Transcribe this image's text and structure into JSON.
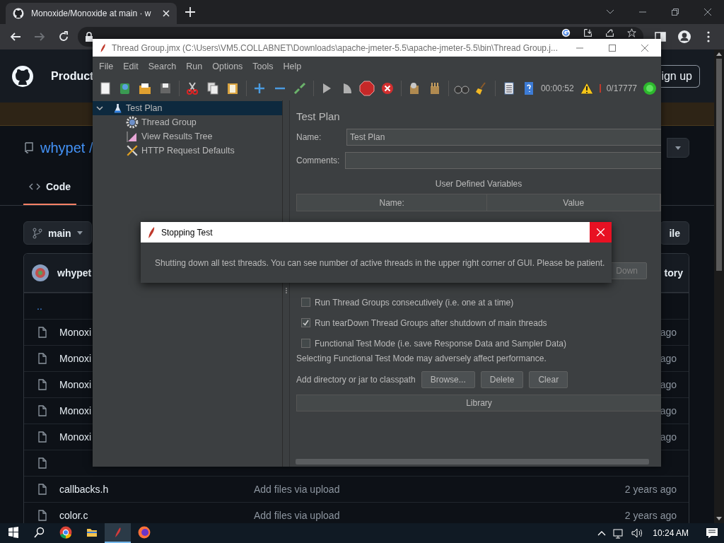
{
  "browser": {
    "tab": {
      "title": "Monoxide/Monoxide at main · w"
    }
  },
  "github": {
    "nav": "Product",
    "signup": "ign up",
    "repo_owner": "whypet /",
    "tabs": [
      {
        "label": "Code",
        "selected": true
      }
    ],
    "branch": "main",
    "file_button": "ile",
    "commit_author": "whypet",
    "history": "tory",
    "rows": [
      {
        "kind": "parent",
        "name": ".."
      },
      {
        "kind": "file",
        "name": "Monoxi",
        "time": "ago"
      },
      {
        "kind": "file",
        "name": "Monoxi",
        "time": "ago"
      },
      {
        "kind": "file",
        "name": "Monoxi",
        "time": "ago"
      },
      {
        "kind": "file",
        "name": "Monoxi",
        "time": "ago"
      },
      {
        "kind": "file",
        "name": "Monoxi",
        "time": "ago"
      },
      {
        "kind": "file"
      },
      {
        "kind": "file",
        "name": "callbacks.h",
        "message": "Add files via upload",
        "time": "2 years ago"
      },
      {
        "kind": "file",
        "name": "color.c",
        "message": "Add files via upload",
        "time": "2 years ago"
      }
    ]
  },
  "jmeter": {
    "title": "Thread Group.jmx (C:\\Users\\VM5.COLLABNET\\Downloads\\apache-jmeter-5.5\\apache-jmeter-5.5\\bin\\Thread Group.j...",
    "menu": [
      "File",
      "Edit",
      "Search",
      "Run",
      "Options",
      "Tools",
      "Help"
    ],
    "elapsed": "00:00:52",
    "threads": "0/17777",
    "tree": [
      {
        "label": "Test Plan",
        "kind": "plan",
        "selected": true,
        "expanded": true,
        "children": [
          {
            "label": "Thread Group",
            "kind": "thread",
            "selected": false
          },
          {
            "label": "View Results Tree",
            "kind": "listener",
            "selected": false
          },
          {
            "label": "HTTP Request Defaults",
            "kind": "config",
            "selected": false
          }
        ]
      }
    ],
    "panel": {
      "heading": "Test Plan",
      "name_label": "Name:",
      "name_value": "Test Plan",
      "comments_label": "Comments:",
      "variables_title": "User Defined Variables",
      "columns": [
        "Name:",
        "Value"
      ],
      "down_button": "Down",
      "checkboxes": [
        {
          "label": "Run Thread Groups consecutively (i.e. one at a time)",
          "checked": false
        },
        {
          "label": "Run tearDown Thread Groups after shutdown of main threads",
          "checked": true
        },
        {
          "label": "Functional Test Mode (i.e. save Response Data and Sampler Data)",
          "checked": false
        }
      ],
      "note": "Selecting Functional Test Mode may adversely affect performance.",
      "classpath_label": "Add directory or jar to classpath",
      "buttons": [
        "Browse...",
        "Delete",
        "Clear"
      ],
      "library": "Library"
    }
  },
  "dialog": {
    "title": "Stopping Test",
    "message": "Shutting down all test threads. You can see number of active threads in the upper right corner of GUI. Please be patient."
  },
  "taskbar": {
    "apps": [
      {
        "kind": "chrome",
        "selected": false
      },
      {
        "kind": "explorer",
        "selected": false
      },
      {
        "kind": "jmeter",
        "selected": true
      },
      {
        "kind": "firefox",
        "selected": false
      }
    ],
    "time": "10:24 AM"
  }
}
